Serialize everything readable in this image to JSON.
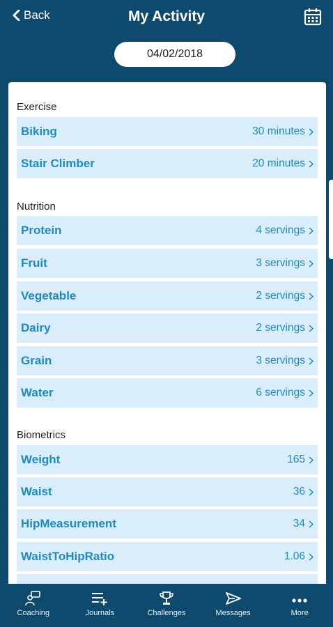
{
  "header": {
    "back_label": "Back",
    "title": "My Activity",
    "calendar_icon": "calendar-icon"
  },
  "date": "04/02/2018",
  "sections": {
    "exercise": {
      "title": "Exercise",
      "items": [
        {
          "label": "Biking",
          "value": "30 minutes"
        },
        {
          "label": "Stair Climber",
          "value": "20 minutes"
        }
      ]
    },
    "nutrition": {
      "title": "Nutrition",
      "items": [
        {
          "label": "Protein",
          "value": "4 servings"
        },
        {
          "label": "Fruit",
          "value": "3 servings"
        },
        {
          "label": "Vegetable",
          "value": "2 servings"
        },
        {
          "label": "Dairy",
          "value": "2 servings"
        },
        {
          "label": "Grain",
          "value": "3 servings"
        },
        {
          "label": "Water",
          "value": "6 servings"
        }
      ]
    },
    "biometrics": {
      "title": "Biometrics",
      "items": [
        {
          "label": "Weight",
          "value": "165"
        },
        {
          "label": "Waist",
          "value": "36"
        },
        {
          "label": "HipMeasurement",
          "value": "34"
        },
        {
          "label": "WaistToHipRatio",
          "value": "1.06"
        }
      ]
    }
  },
  "tabs": [
    {
      "label": "Coaching",
      "icon": "coaching-icon"
    },
    {
      "label": "Journals",
      "icon": "journals-icon"
    },
    {
      "label": "Challenges",
      "icon": "trophy-icon"
    },
    {
      "label": "Messages",
      "icon": "send-icon"
    },
    {
      "label": "More",
      "icon": "more-dots-icon"
    }
  ],
  "colors": {
    "primary": "#0d4a6e",
    "row_bg": "#d9eefa",
    "accent_text": "#1f8ac2"
  }
}
